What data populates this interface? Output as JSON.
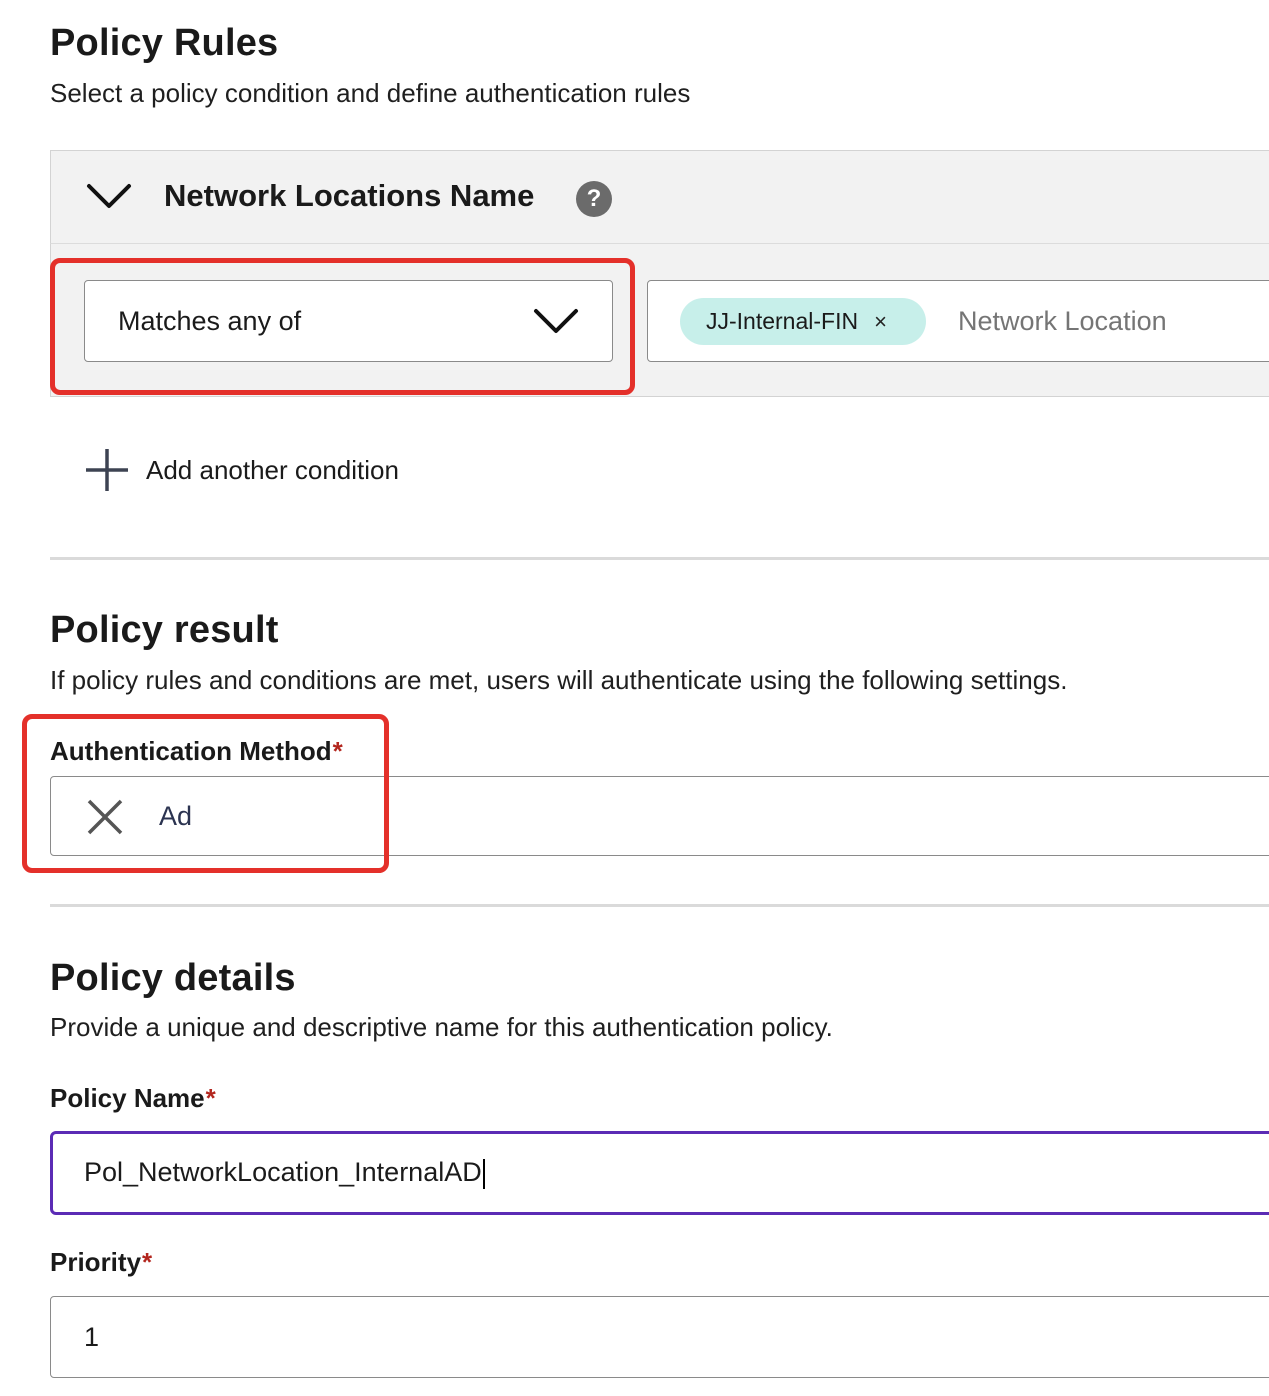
{
  "policy_rules": {
    "title": "Policy Rules",
    "subtitle": "Select a policy condition and define authentication rules",
    "condition": {
      "name": "Network Locations Name",
      "help_glyph": "?",
      "operator": "Matches any of",
      "tags": [
        {
          "label": "JJ-Internal-FIN",
          "remove_glyph": "×"
        }
      ],
      "tag_placeholder": "Network Location"
    },
    "add_condition_label": "Add another condition"
  },
  "policy_result": {
    "title": "Policy result",
    "subtitle": "If policy rules and conditions are met, users will authenticate using the following settings.",
    "auth_method_label": "Authentication Method",
    "auth_method_value": "Ad",
    "required_mark": "*"
  },
  "policy_details": {
    "title": "Policy details",
    "subtitle": "Provide a unique and descriptive name for this authentication policy.",
    "name_label": "Policy Name",
    "name_value": "Pol_NetworkLocation_InternalAD",
    "priority_label": "Priority",
    "priority_value": "1",
    "required_mark": "*"
  },
  "colors": {
    "highlight": "#e4302a",
    "focus": "#5b2bb5",
    "chip": "#c7efea",
    "required": "#b3261e"
  }
}
